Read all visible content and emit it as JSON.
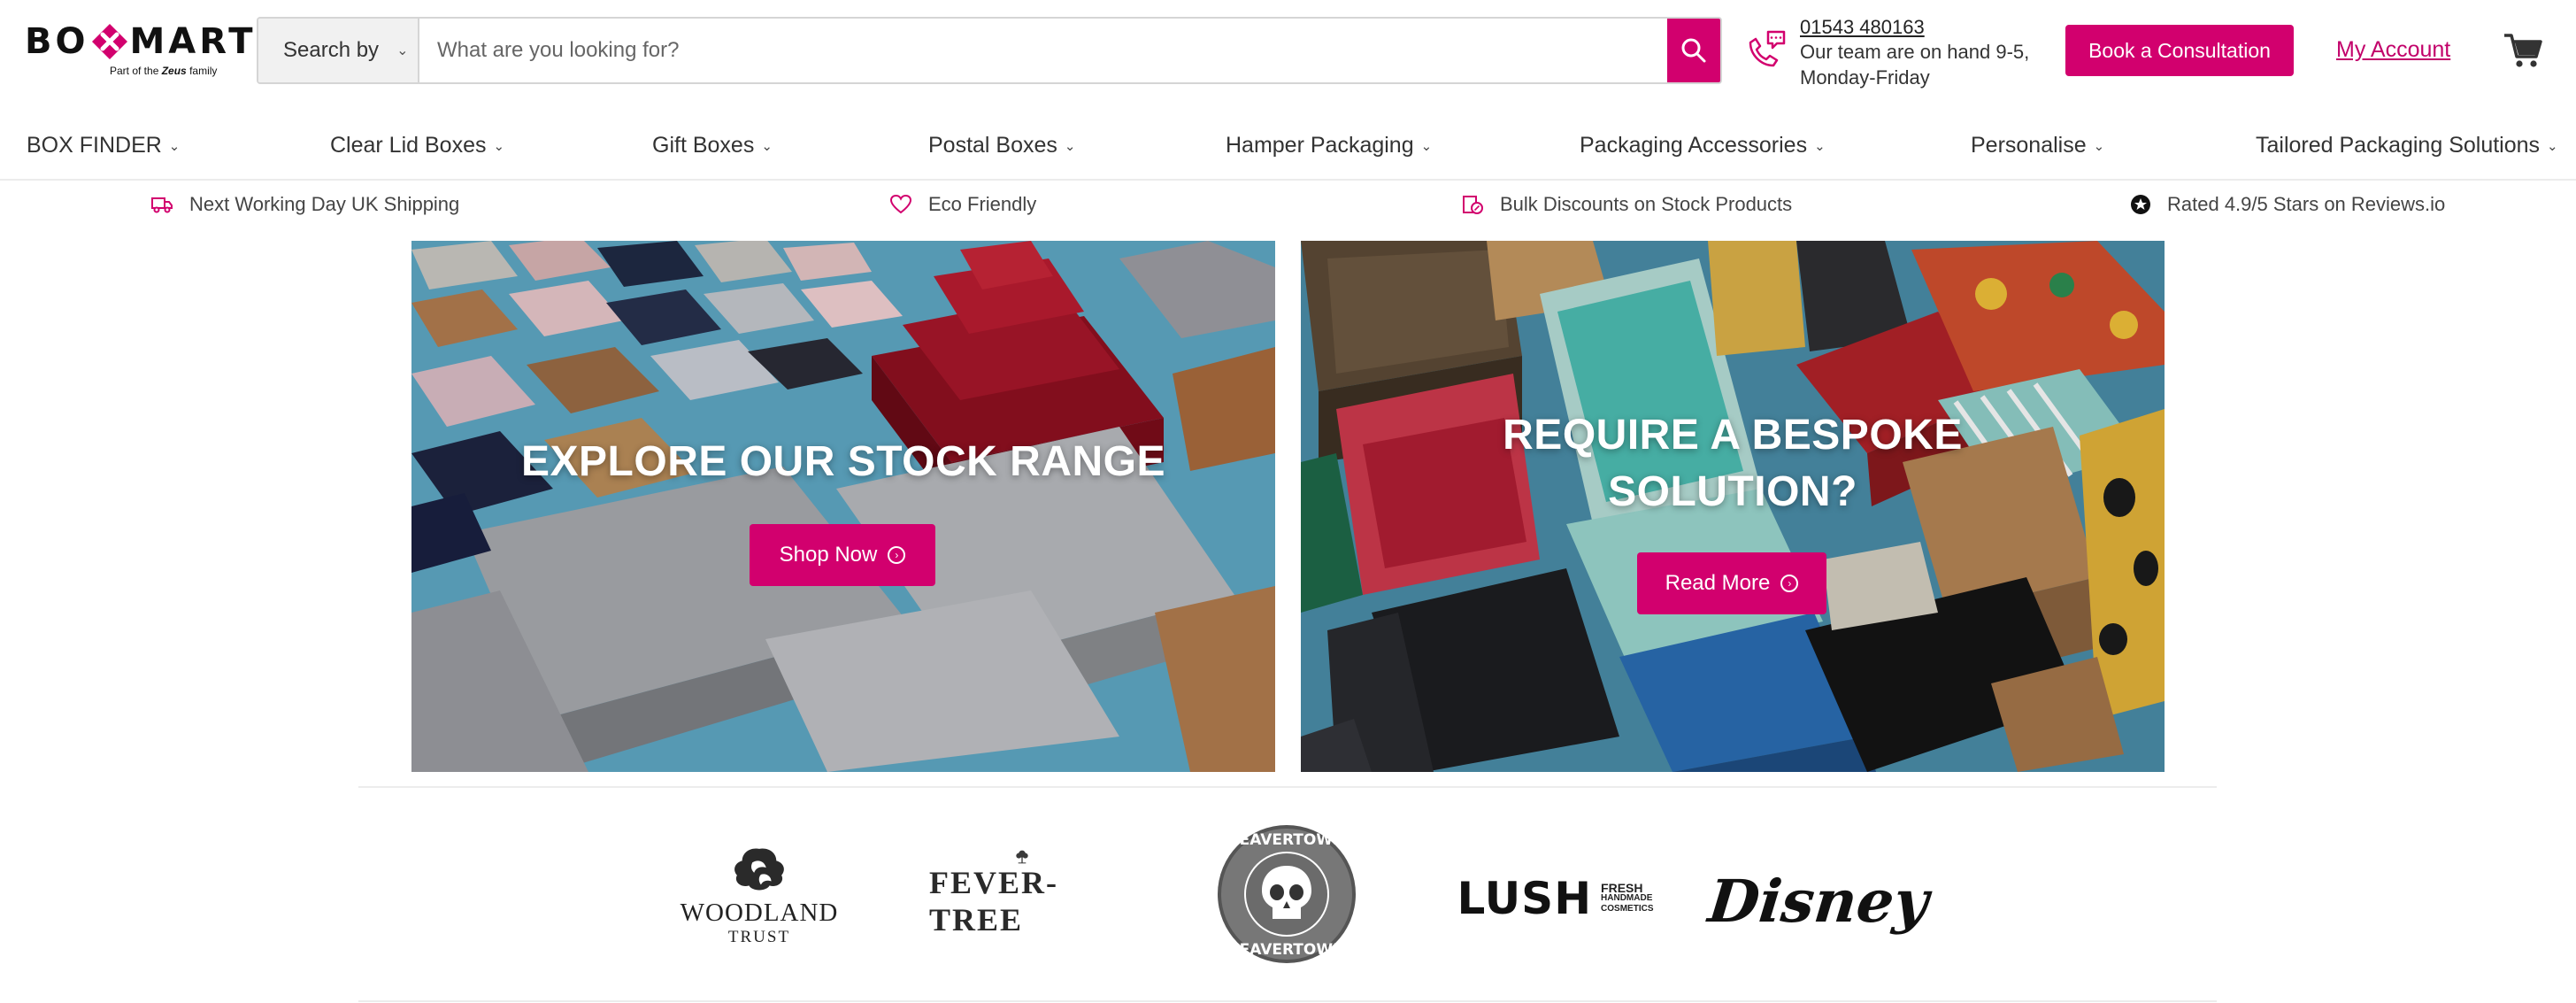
{
  "brand": {
    "logo_parts": [
      "BO",
      "MART"
    ],
    "logo_sub": "Part of the",
    "logo_sub_brand": "Zeus",
    "logo_sub_suffix": "family",
    "accent": "#d2006e"
  },
  "search": {
    "search_by_label": "Search by",
    "placeholder": "What are you looking for?",
    "value": ""
  },
  "contact": {
    "phone": "01543 480163",
    "hours": "Our team are on hand 9-5, Monday-Friday"
  },
  "header": {
    "consult_label": "Book a Consultation",
    "account_label": "My Account"
  },
  "nav": {
    "items": [
      {
        "label": "BOX FINDER"
      },
      {
        "label": "Clear Lid Boxes"
      },
      {
        "label": "Gift Boxes"
      },
      {
        "label": "Postal Boxes"
      },
      {
        "label": "Hamper Packaging"
      },
      {
        "label": "Packaging Accessories"
      },
      {
        "label": "Personalise"
      },
      {
        "label": "Tailored Packaging Solutions"
      }
    ]
  },
  "benefits": [
    {
      "label": "Next Working Day UK Shipping",
      "icon": "truck-icon"
    },
    {
      "label": "Eco Friendly",
      "icon": "heart-icon"
    },
    {
      "label": "Bulk Discounts on Stock Products",
      "icon": "discount-box-icon"
    },
    {
      "label": "Rated 4.9/5 Stars on Reviews.io",
      "icon": "star-badge-icon"
    }
  ],
  "promos": [
    {
      "title": "EXPLORE OUR STOCK RANGE",
      "button": "Shop Now"
    },
    {
      "title_line1": "REQUIRE A BESPOKE",
      "title_line2": "SOLUTION?",
      "button": "Read More"
    }
  ],
  "brands": {
    "woodland": {
      "name": "WOODLAND",
      "sub": "TRUST"
    },
    "fevertree": {
      "name": "FEVER-TREE"
    },
    "beavertown": {
      "name": "BEAVERTOWN"
    },
    "lush": {
      "name": "LUSH",
      "sub1": "FRESH",
      "sub2": "HANDMADE",
      "sub3": "COSMETICS"
    },
    "disney": {
      "name": "Disney"
    }
  }
}
